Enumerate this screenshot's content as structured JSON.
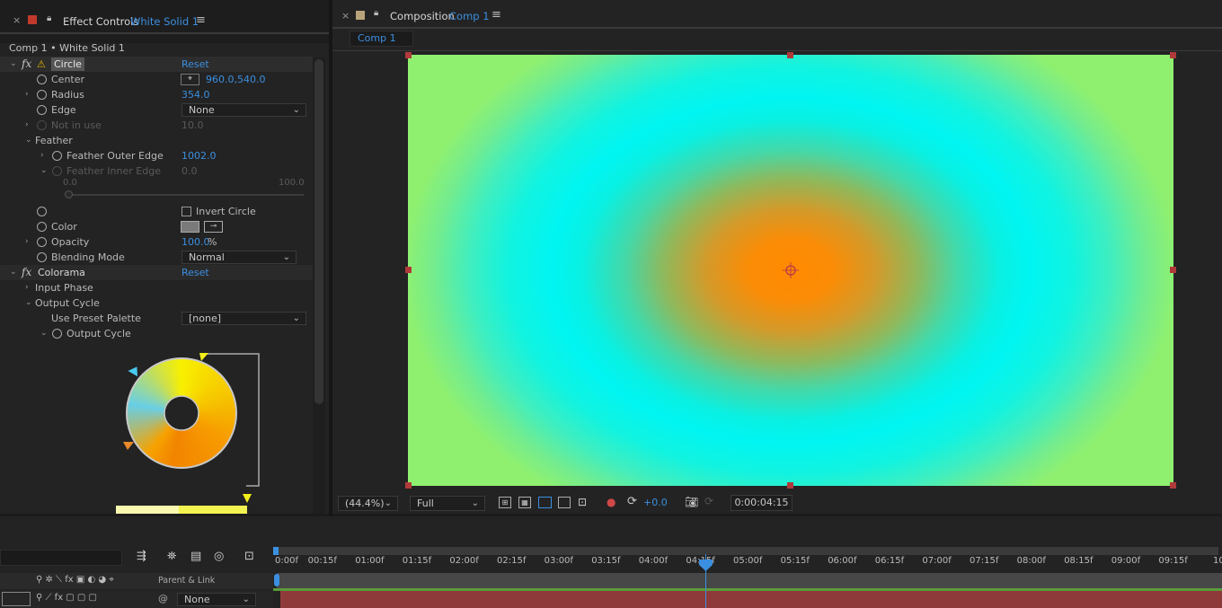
{
  "effect_controls": {
    "tab_title": "Effect Controls",
    "tab_layer": "White Solid 1",
    "breadcrumb": "Comp 1 • White Solid 1",
    "circle": {
      "name": "Circle",
      "reset": "Reset",
      "center_label": "Center",
      "center_value": "960.0,540.0",
      "radius_label": "Radius",
      "radius_value": "354.0",
      "edge_label": "Edge",
      "edge_value": "None",
      "not_in_use_label": "Not in use",
      "not_in_use_value": "10.0",
      "feather_label": "Feather",
      "feather_outer_label": "Feather Outer Edge",
      "feather_outer_value": "1002.0",
      "feather_inner_label": "Feather Inner Edge",
      "feather_inner_value": "0.0",
      "slider_min": "0.0",
      "slider_max": "100.0",
      "invert_label": "Invert Circle",
      "color_label": "Color",
      "opacity_label": "Opacity",
      "opacity_value": "100.0",
      "opacity_unit": "%",
      "blending_label": "Blending Mode",
      "blending_value": "Normal"
    },
    "colorama": {
      "name": "Colorama",
      "reset": "Reset",
      "input_phase_label": "Input Phase",
      "output_cycle_label": "Output Cycle",
      "preset_label": "Use Preset Palette",
      "preset_value": "[none]",
      "output_cycle_prop": "Output Cycle"
    }
  },
  "composition": {
    "tab_title": "Composition",
    "tab_comp": "Comp 1",
    "subtab": "Comp 1",
    "footer": {
      "zoom": "(44.4%)",
      "resolution": "Full",
      "exposure": "+0.0",
      "timecode": "0:00:04:15"
    }
  },
  "timeline": {
    "ruler": [
      "0:00f",
      "00:15f",
      "01:00f",
      "01:15f",
      "02:00f",
      "02:15f",
      "03:00f",
      "03:15f",
      "04:00f",
      "04:15f",
      "05:00f",
      "05:15f",
      "06:00f",
      "06:15f",
      "07:00f",
      "07:15f",
      "08:00f",
      "08:15f",
      "09:00f",
      "09:15f",
      "10"
    ],
    "parent_link_header": "Parent & Link",
    "parent_value": "None"
  },
  "colors": {
    "accent_blue": "#3b8fe0",
    "tab_red": "#c0392b",
    "layer_bar": "#8f3a3a",
    "handle_red": "#b03a3a"
  }
}
